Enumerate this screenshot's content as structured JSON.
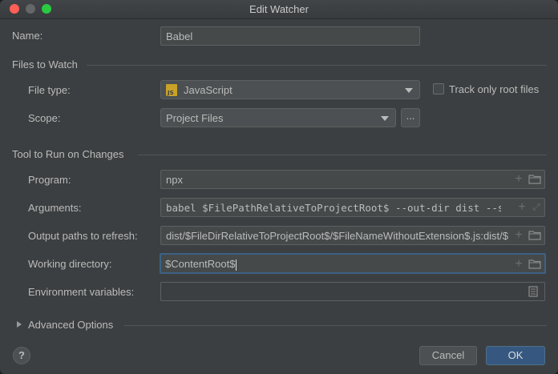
{
  "window": {
    "title": "Edit Watcher"
  },
  "name": {
    "label": "Name:",
    "value": "Babel"
  },
  "files_to_watch": {
    "section_label": "Files to Watch",
    "file_type_label": "File type:",
    "file_type_value": "JavaScript",
    "file_type_icon": "JS",
    "track_root_label": "Track only root files",
    "track_root_checked": false,
    "scope_label": "Scope:",
    "scope_value": "Project Files",
    "scope_more": "..."
  },
  "tool": {
    "section_label": "Tool to Run on Changes",
    "program_label": "Program:",
    "program_value": "npx",
    "arguments_label": "Arguments:",
    "arguments_value": "babel $FilePathRelativeToProjectRoot$ --out-dir dist --source-maps",
    "output_label": "Output paths to refresh:",
    "output_value": "dist/$FileDirRelativeToProjectRoot$/$FileNameWithoutExtension$.js:dist/$FileDirRelativeToProjectRoot$/$FileNameWithoutExtension$.js.map",
    "working_dir_label": "Working directory:",
    "working_dir_value": "$ContentRoot$",
    "env_label": "Environment variables:",
    "env_value": ""
  },
  "advanced": {
    "label": "Advanced Options"
  },
  "footer": {
    "help": "?",
    "cancel": "Cancel",
    "ok": "OK"
  },
  "colors": {
    "window_bg": "#3c3f41",
    "field_bg": "#45494a",
    "focus_border": "#3d6185",
    "ok_button": "#365880"
  }
}
